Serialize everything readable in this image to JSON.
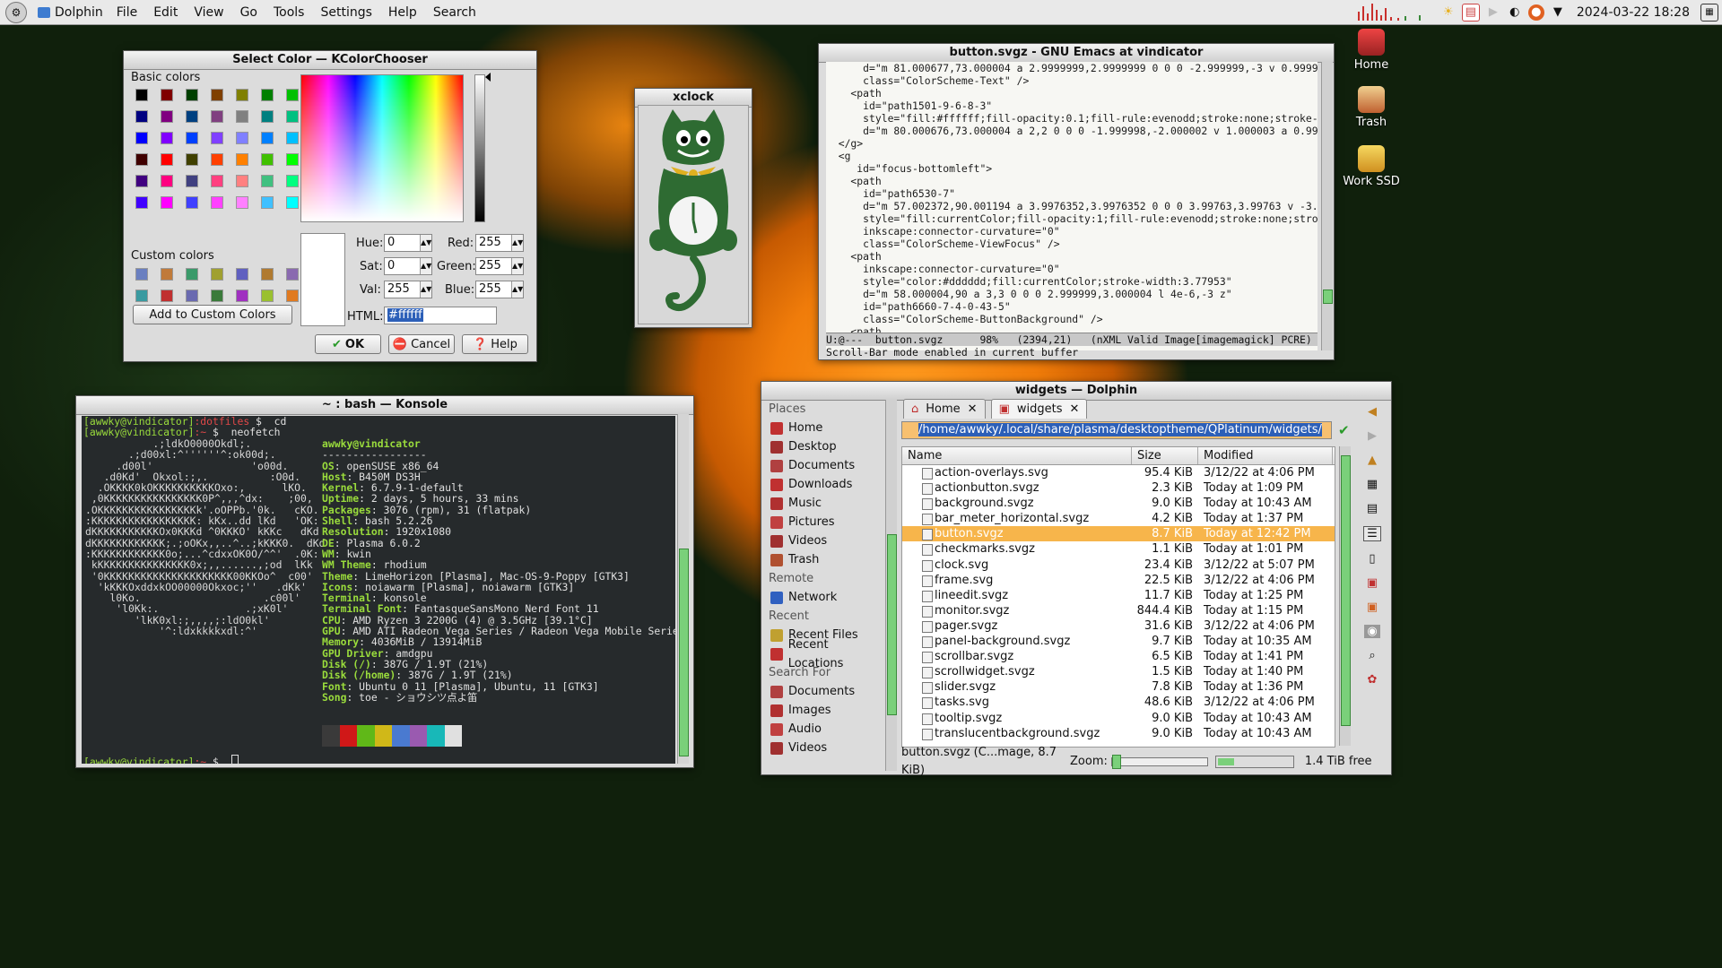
{
  "panel": {
    "app_name": "Dolphin",
    "menus": [
      "File",
      "Edit",
      "View",
      "Go",
      "Tools",
      "Settings",
      "Help",
      "Search"
    ],
    "clock": "2024-03-22  18:28"
  },
  "desktop_icons": [
    {
      "label": "Home",
      "icon": "home-icon"
    },
    {
      "label": "Trash",
      "icon": "trash-icon"
    },
    {
      "label": "Work SSD",
      "icon": "drive-icon"
    }
  ],
  "color_chooser": {
    "title": "Select Color — KColorChooser",
    "basic_label": "Basic colors",
    "custom_label": "Custom colors",
    "add_custom": "Add to Custom Colors",
    "basic_colors": [
      "#000000",
      "#800000",
      "#004000",
      "#804000",
      "#808000",
      "#008000",
      "#00c000",
      "#80ff00",
      "#000080",
      "#800080",
      "#004080",
      "#804080",
      "#808080",
      "#008080",
      "#00c080",
      "#80ff80",
      "#0000ff",
      "#8000ff",
      "#0040ff",
      "#8040ff",
      "#8080ff",
      "#0080ff",
      "#00c0ff",
      "#80ffff",
      "#400000",
      "#ff0000",
      "#404000",
      "#ff4000",
      "#ff8000",
      "#40c000",
      "#00ff00",
      "#ffff00",
      "#400080",
      "#ff0080",
      "#404080",
      "#ff4080",
      "#ff8080",
      "#40c080",
      "#00ff80",
      "#ffff80",
      "#4000ff",
      "#ff00ff",
      "#4040ff",
      "#ff40ff",
      "#ff80ff",
      "#40c0ff",
      "#00ffff",
      "#ffffff"
    ],
    "custom_colors": [
      "#6a7fc0",
      "#c07a3a",
      "#3a9a6a",
      "#a0a030",
      "#6060c0",
      "#b07a30",
      "#8a6ab0",
      "#b06a6a",
      "#3a9aa0",
      "#c03030",
      "#6a6ab0",
      "#3a7a3a",
      "#a030c0",
      "#9ac030",
      "#e07a20",
      "#3a6ae0"
    ],
    "hue_label": "Hue:",
    "hue": "0",
    "sat_label": "Sat:",
    "sat": "0",
    "val_label": "Val:",
    "val": "255",
    "red_label": "Red:",
    "red": "255",
    "green_label": "Green:",
    "green": "255",
    "blue_label": "Blue:",
    "blue": "255",
    "html_label": "HTML:",
    "html_value": "#ffffff",
    "ok": "OK",
    "cancel": "Cancel",
    "help": "Help"
  },
  "xclock": {
    "title": "xclock"
  },
  "emacs": {
    "title": "button.svgz - GNU Emacs at vindicator",
    "lines": [
      "      d=\"m 81.000677,73.000004 a 2.9999999,2.9999999 0 0 0 -2.999999,-3 v 0.999998",
      "      class=\"ColorScheme-Text\" />",
      "    <path",
      "      id=\"path1501-9-6-8-3\"",
      "      style=\"fill:#ffffff;fill-opacity:0.1;fill-rule:evenodd;stroke:none;stroke-wi",
      "      d=\"m 80.000676,73.000004 a 2,2 0 0 0 -1.999998,-2.000002 v 1.000003 a 0.9999",
      "  </g>",
      "  <g",
      "     id=\"focus-bottomleft\">",
      "    <path",
      "      id=\"path6530-7\"",
      "      d=\"m 57.002372,90.001194 a 3.9976352,3.9976352 0 0 0 3.99763,3.99763 v -3.99",
      "      style=\"fill:currentColor;fill-opacity:1;fill-rule:evenodd;stroke:none;stroke",
      "      inkscape:connector-curvature=\"0\"",
      "      class=\"ColorScheme-ViewFocus\" />",
      "    <path",
      "      inkscape:connector-curvature=\"0\"",
      "      style=\"color:#dddddd;fill:currentColor;stroke-width:3.77953\"",
      "      d=\"m 58.000004,90 a 3,3 0 0 0 2.999999,3.000004 l 4e-6,-3 z\"",
      "      id=\"path6660-7-4-0-43-5\"",
      "      class=\"ColorScheme-ButtonBackground\" />",
      "    <path"
    ],
    "modeline": "U:@---  button.svgz      98%   (2394,21)   (nXML Valid Image[imagemagick] PCRE)",
    "echo": "Scroll-Bar mode enabled in current buffer"
  },
  "konsole": {
    "title": "~ : bash — Konsole",
    "prompt_user": "[awwky@vindicator]",
    "line1_dir": ":dotfiles",
    "line1_cmd": " $  cd",
    "line2_dir": ":~",
    "line2_cmd": " $  neofetch",
    "art": [
      "           .;ldkO0000Okdl;.",
      "       .;d00xl:^''''''^:ok00d;.",
      "     .d00l'                'o00d.",
      "   .d0Kd'  Okxol:;,.          :O0d.",
      "  .OKKKK0kOKKKKKKKKKKOxo:,      lKO.",
      " ,0KKKKKKKKKKKKKKKK0P^,,,^dx:    ;00,",
      ".OKKKKKKKKKKKKKKKKk'.oOPPb.'0k.   cKO.",
      ":KKKKKKKKKKKKKKKKK: kKx..dd lKd   'OK:",
      "dKKKKKKKKKKKOx0KKKd ^0KKKO' kKKc   dKd",
      "dKKKKKKKKKKKK;.;oOKx,,..^..;kKKK0.  dKd",
      ":KKKKKKKKKKKK0o;...^cdxxOK0O/^^'  .0K:",
      " kKKKKKKKKKKKKKKK0x;,,......,;od  lKk",
      " '0KKKKKKKKKKKKKKKKKKKKK00KKOo^  c00'",
      "  'kKKKOxddxkOO00000Okxoc;''   .dKk'",
      "    l0Ko.                    .c00l'",
      "     'l0Kk:.              .;xK0l'",
      "        'lkK0xl:;,,,,;:ldO0kl'",
      "            '^:ldxkkkkxdl:^'"
    ],
    "user_host": "awwky@vindicator",
    "separator": "-----------------",
    "info": [
      {
        "k": "OS",
        "v": "openSUSE x86_64"
      },
      {
        "k": "Host",
        "v": "B450M DS3H"
      },
      {
        "k": "Kernel",
        "v": "6.7.9-1-default"
      },
      {
        "k": "Uptime",
        "v": "2 days, 5 hours, 33 mins"
      },
      {
        "k": "Packages",
        "v": "3076 (rpm), 31 (flatpak)"
      },
      {
        "k": "Shell",
        "v": "bash 5.2.26"
      },
      {
        "k": "Resolution",
        "v": "1920x1080"
      },
      {
        "k": "DE",
        "v": "Plasma 6.0.2"
      },
      {
        "k": "WM",
        "v": "kwin"
      },
      {
        "k": "WM Theme",
        "v": "rhodium"
      },
      {
        "k": "Theme",
        "v": "LimeHorizon [Plasma], Mac-OS-9-Poppy [GTK3]"
      },
      {
        "k": "Icons",
        "v": "noiawarm [Plasma], noiawarm [GTK3]"
      },
      {
        "k": "Terminal",
        "v": "konsole"
      },
      {
        "k": "Terminal Font",
        "v": "FantasqueSansMono Nerd Font 11"
      },
      {
        "k": "CPU",
        "v": "AMD Ryzen 3 2200G (4) @ 3.5GHz [39.1°C]"
      },
      {
        "k": "GPU",
        "v": "AMD ATI Radeon Vega Series / Radeon Vega Mobile Series"
      },
      {
        "k": "Memory",
        "v": "4036MiB / 13914MiB"
      },
      {
        "k": "GPU Driver",
        "v": "amdgpu"
      },
      {
        "k": "Disk (/)",
        "v": "387G / 1.9T (21%)"
      },
      {
        "k": "Disk (/home)",
        "v": "387G / 1.9T (21%)"
      },
      {
        "k": "Font",
        "v": "Ubuntu 0 11 [Plasma], Ubuntu, 11 [GTK3]"
      },
      {
        "k": "Song",
        "v": "toe - ショウシツ点よ笛"
      }
    ],
    "palette": [
      "#3a3a3a",
      "#d01818",
      "#60b818",
      "#d0b818",
      "#4a7ad0",
      "#9a5ab0",
      "#18b8b8",
      "#e0e0e0"
    ],
    "last_dir": ":~",
    "last_cmd": " $  "
  },
  "dolphin": {
    "title": "widgets — Dolphin",
    "places_hdr": "Places",
    "places": [
      {
        "label": "Home",
        "icon": "home-icon",
        "color": "#c03030"
      },
      {
        "label": "Desktop",
        "icon": "desktop-icon",
        "color": "#a03030"
      },
      {
        "label": "Documents",
        "icon": "documents-icon",
        "color": "#b04040"
      },
      {
        "label": "Downloads",
        "icon": "downloads-icon",
        "color": "#c03030"
      },
      {
        "label": "Music",
        "icon": "music-icon",
        "color": "#b03030"
      },
      {
        "label": "Pictures",
        "icon": "pictures-icon",
        "color": "#c04040"
      },
      {
        "label": "Videos",
        "icon": "videos-icon",
        "color": "#a03030"
      },
      {
        "label": "Trash",
        "icon": "trash-icon",
        "color": "#b05030"
      }
    ],
    "remote_hdr": "Remote",
    "remote": [
      {
        "label": "Network",
        "icon": "network-icon",
        "color": "#3060c0"
      }
    ],
    "recent_hdr": "Recent",
    "recent": [
      {
        "label": "Recent Files",
        "icon": "recent-files-icon",
        "color": "#c0a030"
      },
      {
        "label": "Recent Locations",
        "icon": "recent-locations-icon",
        "color": "#c03030"
      }
    ],
    "search_hdr": "Search For",
    "search": [
      {
        "label": "Documents",
        "icon": "documents-icon",
        "color": "#b04040"
      },
      {
        "label": "Images",
        "icon": "images-icon",
        "color": "#b03030"
      },
      {
        "label": "Audio",
        "icon": "audio-icon",
        "color": "#c04040"
      },
      {
        "label": "Videos",
        "icon": "videos-icon",
        "color": "#a03030"
      }
    ],
    "tabs": [
      "Home",
      "widgets"
    ],
    "path": "/home/awwky/.local/share/plasma/desktoptheme/QPlatinum/widgets/",
    "columns": {
      "name": "Name",
      "size": "Size",
      "modified": "Modified"
    },
    "files": [
      {
        "name": "action-overlays.svg",
        "size": "95.4 KiB",
        "modified": "3/12/22 at 4:06 PM"
      },
      {
        "name": "actionbutton.svgz",
        "size": "2.3 KiB",
        "modified": "Today at 1:09 PM"
      },
      {
        "name": "background.svgz",
        "size": "9.0 KiB",
        "modified": "Today at 10:43 AM"
      },
      {
        "name": "bar_meter_horizontal.svgz",
        "size": "4.2 KiB",
        "modified": "Today at 1:37 PM"
      },
      {
        "name": "button.svgz",
        "size": "8.7 KiB",
        "modified": "Today at 12:42 PM",
        "selected": true
      },
      {
        "name": "checkmarks.svgz",
        "size": "1.1 KiB",
        "modified": "Today at 1:01 PM"
      },
      {
        "name": "clock.svg",
        "size": "23.4 KiB",
        "modified": "3/12/22 at 5:07 PM"
      },
      {
        "name": "frame.svg",
        "size": "22.5 KiB",
        "modified": "3/12/22 at 4:06 PM"
      },
      {
        "name": "lineedit.svgz",
        "size": "11.7 KiB",
        "modified": "Today at 1:25 PM"
      },
      {
        "name": "monitor.svgz",
        "size": "844.4 KiB",
        "modified": "Today at 1:15 PM"
      },
      {
        "name": "pager.svgz",
        "size": "31.6 KiB",
        "modified": "3/12/22 at 4:06 PM"
      },
      {
        "name": "panel-background.svgz",
        "size": "9.7 KiB",
        "modified": "Today at 10:35 AM"
      },
      {
        "name": "scrollbar.svgz",
        "size": "6.5 KiB",
        "modified": "Today at 1:41 PM"
      },
      {
        "name": "scrollwidget.svgz",
        "size": "1.5 KiB",
        "modified": "Today at 1:40 PM"
      },
      {
        "name": "slider.svgz",
        "size": "7.8 KiB",
        "modified": "Today at 1:36 PM"
      },
      {
        "name": "tasks.svg",
        "size": "48.6 KiB",
        "modified": "3/12/22 at 4:06 PM"
      },
      {
        "name": "tooltip.svgz",
        "size": "9.0 KiB",
        "modified": "Today at 10:43 AM"
      },
      {
        "name": "translucentbackground.svgz",
        "size": "9.0 KiB",
        "modified": "Today at 10:43 AM"
      }
    ],
    "status_file": "button.svgz (C...mage, 8.7 KiB)",
    "zoom_label": "Zoom:",
    "free": "1.4 TiB free"
  },
  "colors": {
    "selection": "#f7b54b",
    "terminal_bg": "#262a2c",
    "terminal_green": "#9adc3c"
  }
}
